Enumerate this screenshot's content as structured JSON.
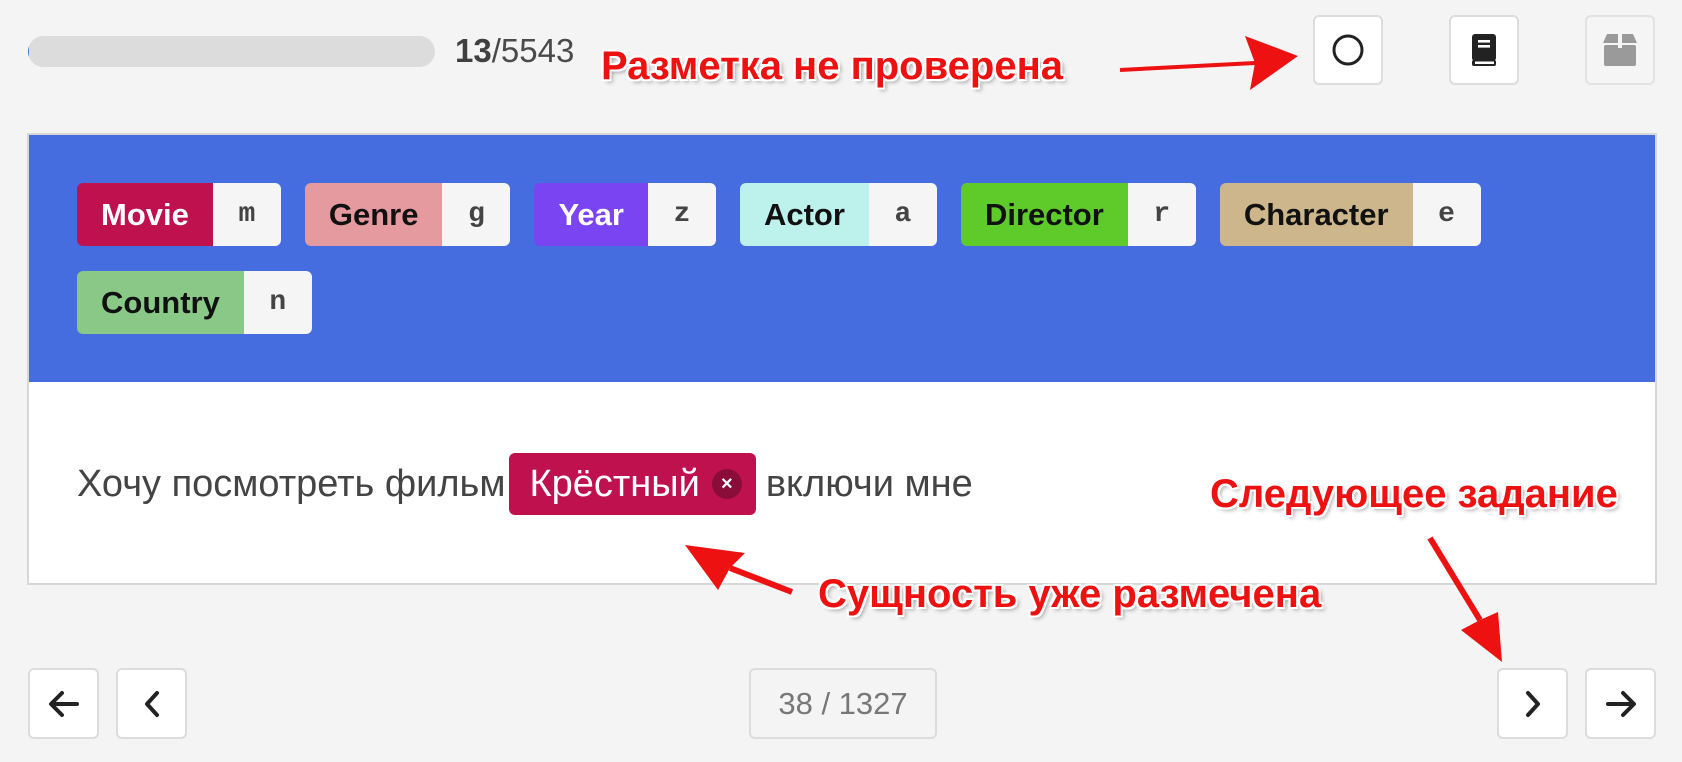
{
  "progress": {
    "done": "13",
    "total": "/5543",
    "fraction": 0.0023
  },
  "toolbar": {
    "status_icon": "circle-outline-icon",
    "guide_icon": "book-icon",
    "archive_icon": "archive-box-icon"
  },
  "labels": [
    {
      "name": "Movie",
      "key": "m",
      "bg": "#c0114f",
      "fg": "#ffffff"
    },
    {
      "name": "Genre",
      "key": "g",
      "bg": "#e59a9f",
      "fg": "#111111"
    },
    {
      "name": "Year",
      "key": "z",
      "bg": "#7a44f2",
      "fg": "#ffffff"
    },
    {
      "name": "Actor",
      "key": "a",
      "bg": "#bdf1ec",
      "fg": "#111111"
    },
    {
      "name": "Director",
      "key": "r",
      "bg": "#5ecb2a",
      "fg": "#111111"
    },
    {
      "name": "Character",
      "key": "e",
      "bg": "#cdb68b",
      "fg": "#111111"
    },
    {
      "name": "Country",
      "key": "n",
      "bg": "#8ac887",
      "fg": "#111111"
    }
  ],
  "text": {
    "before": "Хочу посмотреть фильм",
    "entity": {
      "text": "Крёстный",
      "label": "Movie",
      "color": "#c0114f",
      "remove_symbol": "×"
    },
    "after": "включи мне"
  },
  "pagination": {
    "first_icon": "arrow-left-icon",
    "prev_icon": "chevron-left-icon",
    "page": "38 / 1327",
    "next_icon": "chevron-right-icon",
    "last_icon": "arrow-right-icon"
  },
  "annotations": {
    "not_checked": "Разметка не проверена",
    "already_labeled": "Сущность уже размечена",
    "next_task": "Следующее задание"
  }
}
